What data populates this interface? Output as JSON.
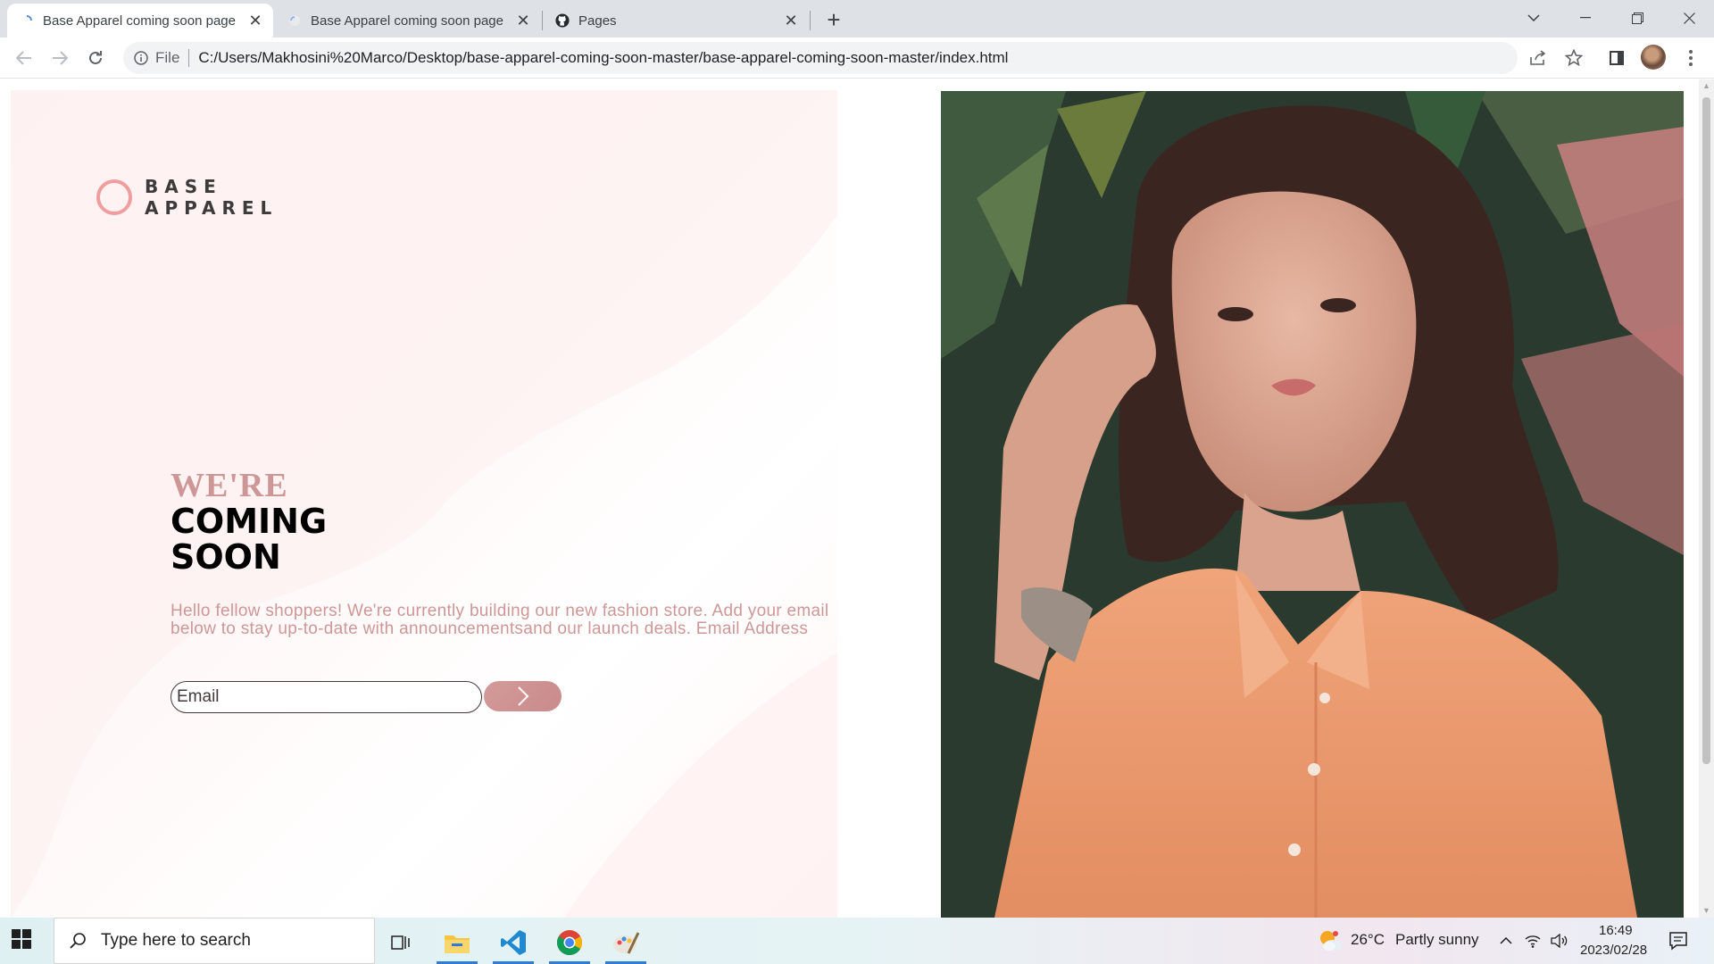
{
  "browser": {
    "tabs": [
      {
        "title": "Base Apparel coming soon page",
        "active": true
      },
      {
        "title": "Base Apparel coming soon page",
        "active": false
      },
      {
        "title": "Pages",
        "active": false
      }
    ],
    "address": {
      "scheme_label": "File",
      "url": "C:/Users/Makhosini%20Marco/Desktop/base-apparel-coming-soon-master/base-apparel-coming-soon-master/index.html"
    }
  },
  "page": {
    "logo": {
      "line1": "BASE",
      "line2": "APPAREL"
    },
    "heading": {
      "line1": "WE'RE",
      "line2": "COMING",
      "line3": "SOON"
    },
    "description": "Hello fellow shoppers! We're currently building our new fashion store. Add your email below to stay up-to-date with announcementsand our launch deals. Email Address",
    "email_placeholder": "Email",
    "colors": {
      "accent": "#ce9797",
      "ring": "#f29d9d",
      "dark": "#423a3a"
    }
  },
  "taskbar": {
    "search_placeholder": "Type here to search",
    "apps": [
      "task-view",
      "file-explorer",
      "vs-code",
      "chrome",
      "paint"
    ],
    "weather": {
      "temp": "26°C",
      "condition": "Partly sunny"
    },
    "clock": {
      "time": "16:49",
      "date": "2023/02/28"
    }
  }
}
